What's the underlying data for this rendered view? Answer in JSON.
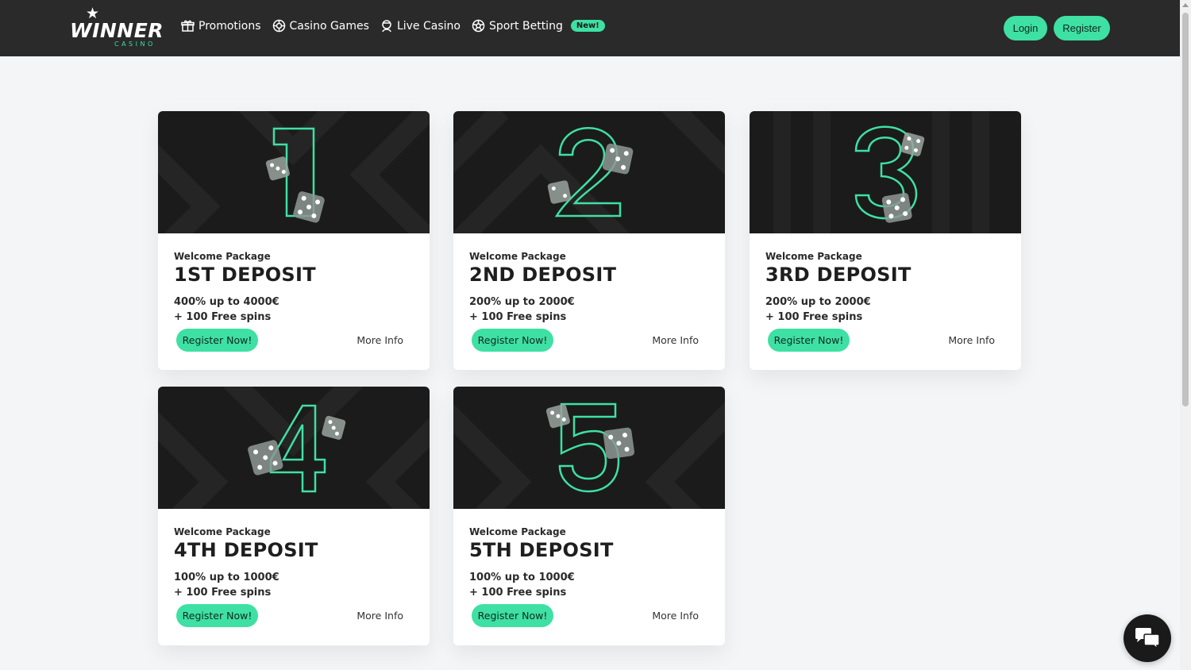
{
  "brand": {
    "name": "WINNER",
    "sub": "CASINO",
    "accent_color": "#3ee0a4",
    "header_color": "#2a2a2a"
  },
  "nav": {
    "items": [
      {
        "label": "Promotions",
        "icon": "gift-icon"
      },
      {
        "label": "Casino Games",
        "icon": "chip-icon"
      },
      {
        "label": "Live Casino",
        "icon": "dealer-icon"
      },
      {
        "label": "Sport Betting",
        "icon": "soccer-ball-icon"
      }
    ],
    "new_badge": "New!"
  },
  "auth": {
    "login_label": "Login",
    "register_label": "Register"
  },
  "cards": [
    {
      "numeral": "1",
      "subtitle": "Welcome Package",
      "title": "1ST DEPOSIT",
      "line1": "400% up to 4000€",
      "line2": "+ 100 Free spins",
      "cta": "Register Now!",
      "more": "More Info"
    },
    {
      "numeral": "2",
      "subtitle": "Welcome Package",
      "title": "2ND DEPOSIT",
      "line1": "200% up to 2000€",
      "line2": "+ 100 Free spins",
      "cta": "Register Now!",
      "more": "More Info"
    },
    {
      "numeral": "3",
      "subtitle": "Welcome Package",
      "title": "3RD DEPOSIT",
      "line1": "200% up to 2000€",
      "line2": "+ 100 Free spins",
      "cta": "Register Now!",
      "more": "More Info"
    },
    {
      "numeral": "4",
      "subtitle": "Welcome Package",
      "title": "4TH DEPOSIT",
      "line1": "100% up to 1000€",
      "line2": "+ 100 Free spins",
      "cta": "Register Now!",
      "more": "More Info"
    },
    {
      "numeral": "5",
      "subtitle": "Welcome Package",
      "title": "5TH DEPOSIT",
      "line1": "100% up to 1000€",
      "line2": "+ 100 Free spins",
      "cta": "Register Now!",
      "more": "More Info"
    }
  ],
  "chat": {
    "icon": "chat-bubbles-icon"
  }
}
